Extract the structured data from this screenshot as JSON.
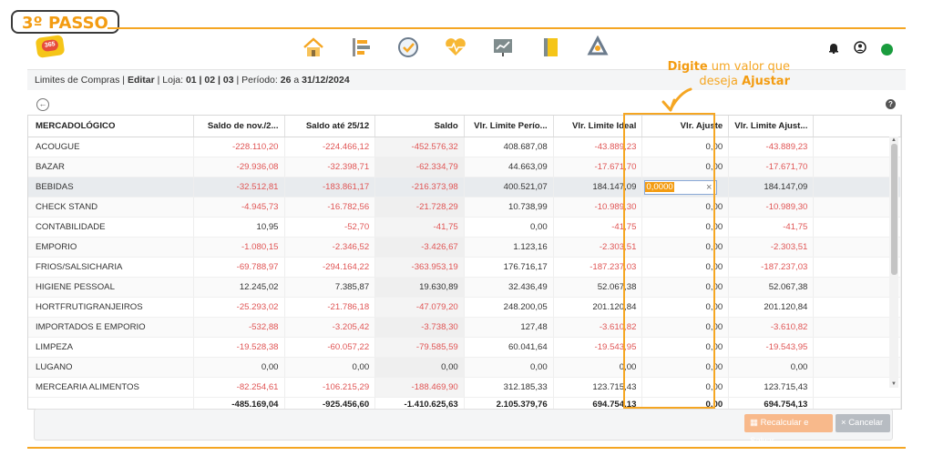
{
  "step_label": "3º PASSO",
  "annotation": {
    "line1_bold": "Digite",
    "line1_rest": " um valor que",
    "line2_rest": "deseja ",
    "line2_bold": "Ajustar"
  },
  "logo_text": "365",
  "nav_icons": [
    "home-icon",
    "list-icon",
    "check-circle-icon",
    "heartbeat-icon",
    "chart-board-icon",
    "notebook-icon",
    "recycle-icon"
  ],
  "nav_right": [
    "bell-icon",
    "user-icon",
    "status-online-dot"
  ],
  "colors": {
    "accent": "#f5a623",
    "negative": "#e05555",
    "status": "#1a9c3e"
  },
  "breadcrumb": {
    "part1": "Limites de Compras | ",
    "edit": "Editar",
    "part2": " | Loja: ",
    "store": "01 | 02 | 03",
    "part3": " | Período: ",
    "period_day": "26",
    "part4": " a ",
    "period_end": "31/12/2024"
  },
  "columns": [
    "MERCADOLÓGICO",
    "Saldo de nov./2...",
    "Saldo até 25/12",
    "Saldo",
    "Vlr. Limite Perío...",
    "Vlr. Limite Ideal",
    "Vlr. Ajuste",
    "Vlr. Limite Ajust..."
  ],
  "rows": [
    {
      "name": "ACOUGUE",
      "c1": "-228.110,20",
      "c2": "-224.466,12",
      "c3": "-452.576,32",
      "c4": "408.687,08",
      "c5": "-43.889,23",
      "c6": "0,00",
      "c7": "-43.889,23"
    },
    {
      "name": "BAZAR",
      "c1": "-29.936,08",
      "c2": "-32.398,71",
      "c3": "-62.334,79",
      "c4": "44.663,09",
      "c5": "-17.671,70",
      "c6": "0,00",
      "c7": "-17.671,70"
    },
    {
      "name": "BEBIDAS",
      "c1": "-32.512,81",
      "c2": "-183.861,17",
      "c3": "-216.373,98",
      "c4": "400.521,07",
      "c5": "184.147,09",
      "c6": "0,0000",
      "c7": "184.147,09"
    },
    {
      "name": "CHECK STAND",
      "c1": "-4.945,73",
      "c2": "-16.782,56",
      "c3": "-21.728,29",
      "c4": "10.738,99",
      "c5": "-10.989,30",
      "c6": "0,00",
      "c7": "-10.989,30"
    },
    {
      "name": "CONTABILIDADE",
      "c1": "10,95",
      "c2": "-52,70",
      "c3": "-41,75",
      "c4": "0,00",
      "c5": "-41,75",
      "c6": "0,00",
      "c7": "-41,75"
    },
    {
      "name": "EMPORIO",
      "c1": "-1.080,15",
      "c2": "-2.346,52",
      "c3": "-3.426,67",
      "c4": "1.123,16",
      "c5": "-2.303,51",
      "c6": "0,00",
      "c7": "-2.303,51"
    },
    {
      "name": "FRIOS/SALSICHARIA",
      "c1": "-69.788,97",
      "c2": "-294.164,22",
      "c3": "-363.953,19",
      "c4": "176.716,17",
      "c5": "-187.237,03",
      "c6": "0,00",
      "c7": "-187.237,03"
    },
    {
      "name": "HIGIENE PESSOAL",
      "c1": "12.245,02",
      "c2": "7.385,87",
      "c3": "19.630,89",
      "c4": "32.436,49",
      "c5": "52.067,38",
      "c6": "0,00",
      "c7": "52.067,38"
    },
    {
      "name": "HORTFRUTIGRANJEIROS",
      "c1": "-25.293,02",
      "c2": "-21.786,18",
      "c3": "-47.079,20",
      "c4": "248.200,05",
      "c5": "201.120,84",
      "c6": "0,00",
      "c7": "201.120,84"
    },
    {
      "name": "IMPORTADOS E EMPORIO",
      "c1": "-532,88",
      "c2": "-3.205,42",
      "c3": "-3.738,30",
      "c4": "127,48",
      "c5": "-3.610,82",
      "c6": "0,00",
      "c7": "-3.610,82"
    },
    {
      "name": "LIMPEZA",
      "c1": "-19.528,38",
      "c2": "-60.057,22",
      "c3": "-79.585,59",
      "c4": "60.041,64",
      "c5": "-19.543,95",
      "c6": "0,00",
      "c7": "-19.543,95"
    },
    {
      "name": "LUGANO",
      "c1": "0,00",
      "c2": "0,00",
      "c3": "0,00",
      "c4": "0,00",
      "c5": "0,00",
      "c6": "0,00",
      "c7": "0,00"
    },
    {
      "name": "MERCEARIA ALIMENTOS",
      "c1": "-82.254,61",
      "c2": "-106.215,29",
      "c3": "-188.469,90",
      "c4": "312.185,33",
      "c5": "123.715,43",
      "c6": "0,00",
      "c7": "123.715,43"
    }
  ],
  "totals": {
    "c1": "-485.169,04",
    "c2": "-925.456,60",
    "c3": "-1.410.625,63",
    "c4": "2.105.379,76",
    "c5": "694.754,13",
    "c6": "0,00",
    "c7": "694.754,13"
  },
  "buttons": {
    "recalc": "Recalcular e Salvar",
    "cancel": "Cancelar"
  }
}
